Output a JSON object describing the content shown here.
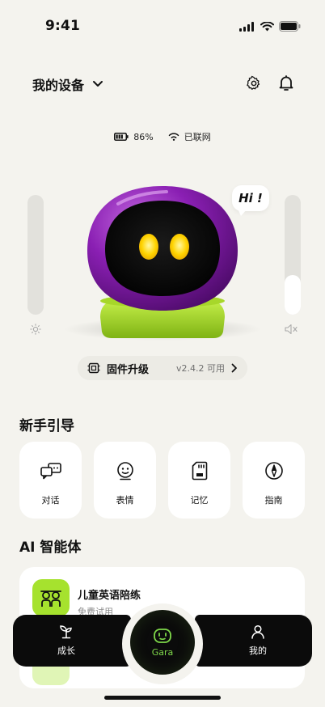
{
  "status_bar": {
    "time": "9:41"
  },
  "header": {
    "title": "我的设备"
  },
  "device_status": {
    "battery": "86%",
    "network": "已联网"
  },
  "robot": {
    "speech": "Hi !",
    "brightness_level": 0.0,
    "volume_level": 0.33
  },
  "firmware": {
    "label": "固件升级",
    "version": "v2.4.2 可用"
  },
  "guide": {
    "title": "新手引导",
    "items": [
      {
        "label": "对话",
        "icon": "chat-icon"
      },
      {
        "label": "表情",
        "icon": "face-icon"
      },
      {
        "label": "记忆",
        "icon": "sd-card-icon"
      },
      {
        "label": "指南",
        "icon": "compass-icon"
      }
    ]
  },
  "agents": {
    "title": "AI 智能体",
    "items": [
      {
        "name": "儿童英语陪练",
        "sub": "免费试用"
      }
    ]
  },
  "nav": {
    "left": {
      "label": "成长",
      "icon": "sprout-icon"
    },
    "center": {
      "label": "Gara",
      "icon": "robot-icon"
    },
    "right": {
      "label": "我的",
      "icon": "person-icon"
    }
  },
  "colors": {
    "accent": "#a6e22e",
    "robot_purple": "#7b1fa2",
    "nav_bg": "#0b0b0b"
  }
}
